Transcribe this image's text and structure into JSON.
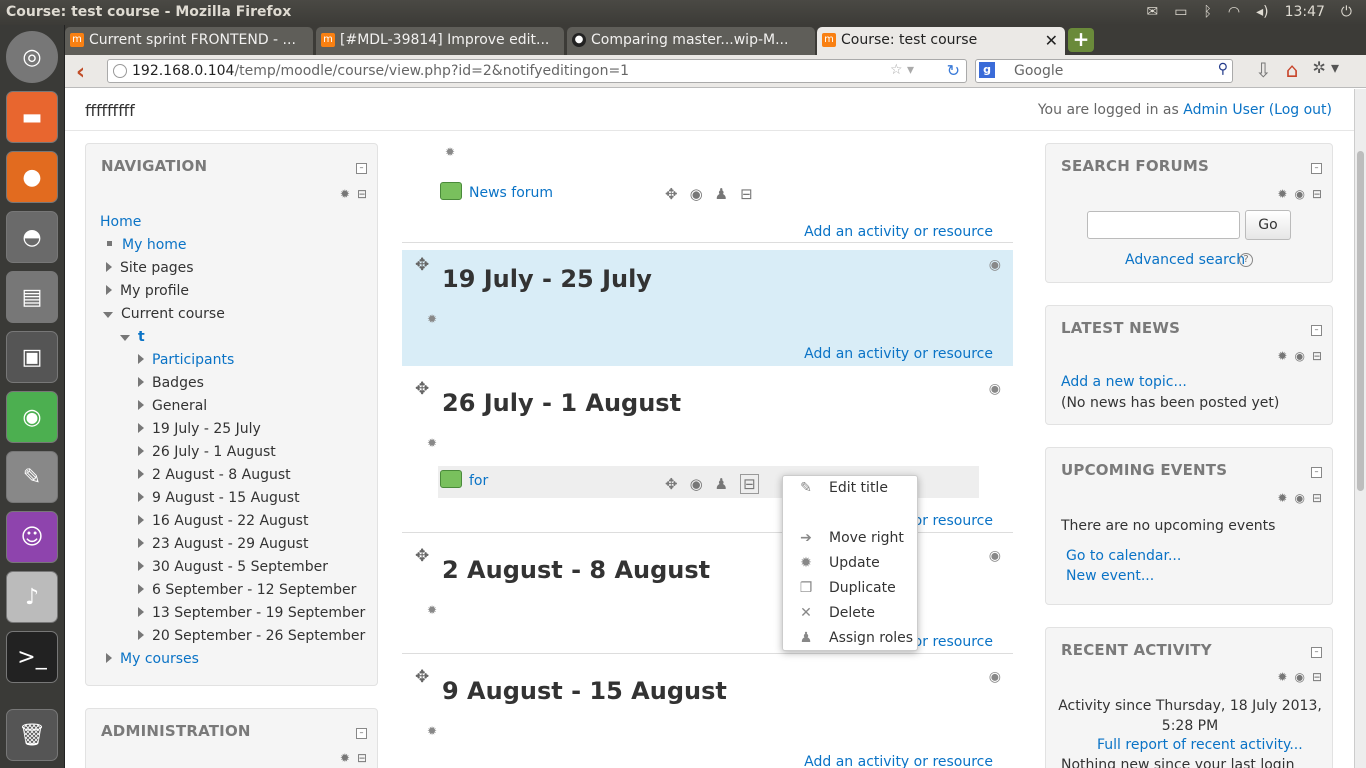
{
  "window": {
    "title": "Course: test course - Mozilla Firefox"
  },
  "system": {
    "clock": "13:47"
  },
  "tabs": [
    {
      "label": "Current sprint FRONTEND - ...",
      "active": false
    },
    {
      "label": "[#MDL-39814] Improve edit...",
      "active": false
    },
    {
      "label": "Comparing master...wip-M...",
      "active": false
    },
    {
      "label": "Course: test course",
      "active": true
    }
  ],
  "toolbar": {
    "url_host": "192.168.0.104",
    "url_path": "/temp/moodle/course/view.php?id=2&notifyeditingon=1",
    "search_placeholder": "Google"
  },
  "header": {
    "site_name": "fffffffff",
    "login_prefix": "You are logged in as ",
    "user": "Admin User",
    "logout": "(Log out)"
  },
  "navigation": {
    "title": "NAVIGATION",
    "home": "Home",
    "my_home": "My home",
    "site_pages": "Site pages",
    "my_profile": "My profile",
    "current_course": "Current course",
    "course_short": "t",
    "participants": "Participants",
    "badges": "Badges",
    "general": "General",
    "weeks": [
      "19 July - 25 July",
      "26 July - 1 August",
      "2 August - 8 August",
      "9 August - 15 August",
      "16 August - 22 August",
      "23 August - 29 August",
      "30 August - 5 September",
      "6 September - 12 September",
      "13 September - 19 September",
      "20 September - 26 September"
    ],
    "my_courses": "My courses"
  },
  "administration": {
    "title": "ADMINISTRATION"
  },
  "course": {
    "news_forum": "News forum",
    "add_activity": "Add an activity or resource",
    "add_activity_partial": "or resource",
    "sections": [
      {
        "title": "19 July - 25 July"
      },
      {
        "title": "26 July - 1 August",
        "activity": "for"
      },
      {
        "title": "2 August - 8 August"
      },
      {
        "title": "9 August - 15 August"
      }
    ]
  },
  "action_menu": {
    "edit_title": "Edit title",
    "move_right": "Move right",
    "update": "Update",
    "duplicate": "Duplicate",
    "delete": "Delete",
    "assign_roles": "Assign roles"
  },
  "search_forums": {
    "title": "SEARCH FORUMS",
    "go": "Go",
    "advanced": "Advanced search"
  },
  "latest_news": {
    "title": "LATEST NEWS",
    "add_topic": "Add a new topic...",
    "empty": "(No news has been posted yet)"
  },
  "upcoming_events": {
    "title": "UPCOMING EVENTS",
    "empty": "There are no upcoming events",
    "calendar": "Go to calendar...",
    "new_event": "New event..."
  },
  "recent_activity": {
    "title": "RECENT ACTIVITY",
    "since_line1": "Activity since Thursday, 18 July 2013,",
    "since_line2": "5:28 PM",
    "full_report": "Full report of recent activity...",
    "nothing_new": "Nothing new since your last login"
  }
}
